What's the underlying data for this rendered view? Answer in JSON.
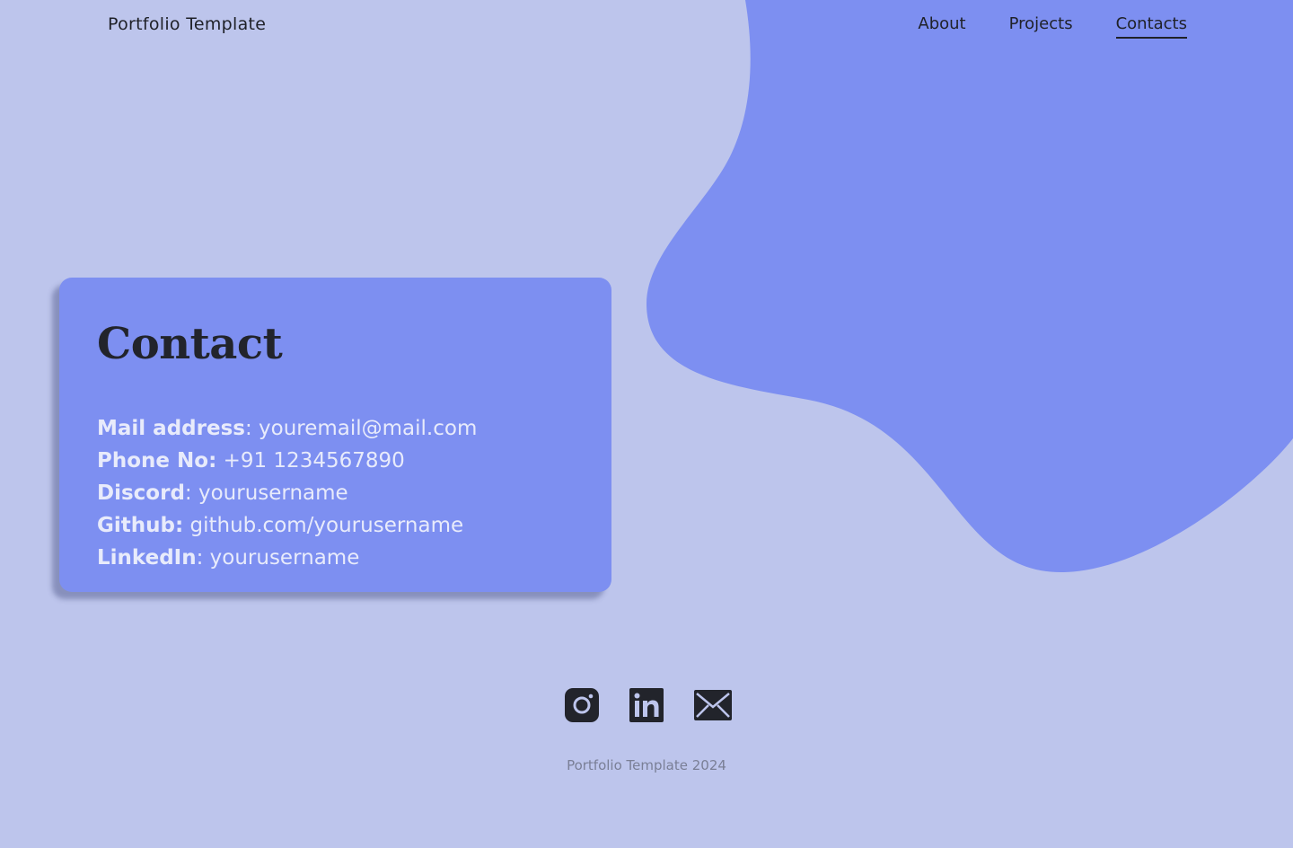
{
  "header": {
    "brand": "Portfolio Template",
    "nav": [
      {
        "label": "About"
      },
      {
        "label": "Projects"
      },
      {
        "label": "Contacts",
        "active": true
      }
    ]
  },
  "contact_card": {
    "title": "Contact",
    "rows": [
      {
        "key": "Mail address",
        "value": ": youremail@mail.com"
      },
      {
        "key": "Phone No:",
        "value": " +91 1234567890"
      },
      {
        "key": "Discord",
        "value": ": yourusername"
      },
      {
        "key": "Github:",
        "value": " github.com/yourusername"
      },
      {
        "key": "LinkedIn",
        "value": ": yourusername"
      }
    ]
  },
  "socials": [
    {
      "icon": "instagram-icon"
    },
    {
      "icon": "linkedin-icon"
    },
    {
      "icon": "mail-icon"
    }
  ],
  "footer": {
    "text": "Portfolio Template 2024"
  },
  "colors": {
    "background": "#bdc5ec",
    "accent": "#7d8ff1",
    "text_dark": "#1f2128",
    "text_light": "#e8ebfb"
  }
}
